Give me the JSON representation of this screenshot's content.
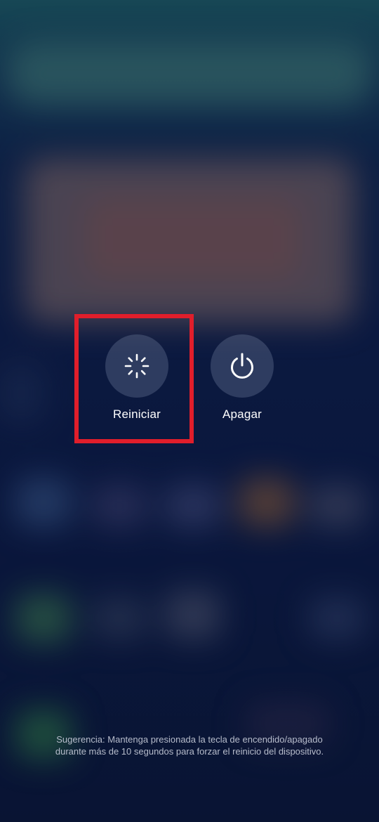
{
  "power_menu": {
    "restart": {
      "label": "Reiniciar",
      "icon": "restart-spinner-icon"
    },
    "power_off": {
      "label": "Apagar",
      "icon": "power-icon"
    },
    "hint_line1": "Sugerencia: Mantenga presionada la tecla de encendido/apagado",
    "hint_line2": "durante más de 10 segundos para forzar el reinicio del dispositivo."
  },
  "colors": {
    "highlight": "#e01e2b",
    "button_bg": "rgba(105,118,150,0.38)",
    "label_text": "#ffffff",
    "hint_text": "#b6bccb"
  }
}
